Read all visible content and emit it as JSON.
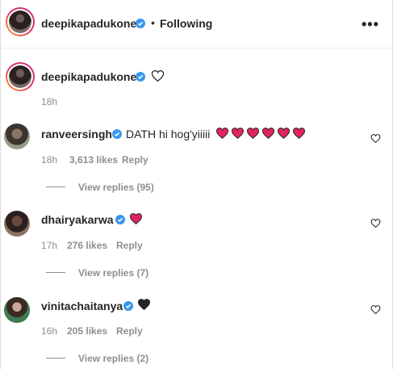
{
  "header": {
    "username": "deepikapadukone",
    "separator": "•",
    "following_label": "Following",
    "more_label": "•••"
  },
  "caption": {
    "username": "deepikapadukone",
    "time": "18h"
  },
  "comments": [
    {
      "username": "ranveersingh",
      "text": "DATH hi hog'yiiiii",
      "hearts": 6,
      "heart_color": "#e0245e",
      "time": "18h",
      "likes": "3,613 likes",
      "reply_label": "Reply",
      "view_replies": "View replies (95)"
    },
    {
      "username": "dhairyakarwa",
      "text": "",
      "hearts": 1,
      "heart_color": "#e0245e",
      "time": "17h",
      "likes": "276 likes",
      "reply_label": "Reply",
      "view_replies": "View replies (7)"
    },
    {
      "username": "vinitachaitanya",
      "text": "",
      "hearts": 1,
      "heart_color": "#262626",
      "time": "16h",
      "likes": "205 likes",
      "reply_label": "Reply",
      "view_replies": "View replies (2)"
    }
  ],
  "colors": {
    "verified": "#3897f0",
    "muted": "#8e8e8e",
    "text": "#262626"
  },
  "icons": {
    "verified": "verified-badge-icon",
    "like": "heart-outline-icon",
    "more": "more-options-icon"
  }
}
